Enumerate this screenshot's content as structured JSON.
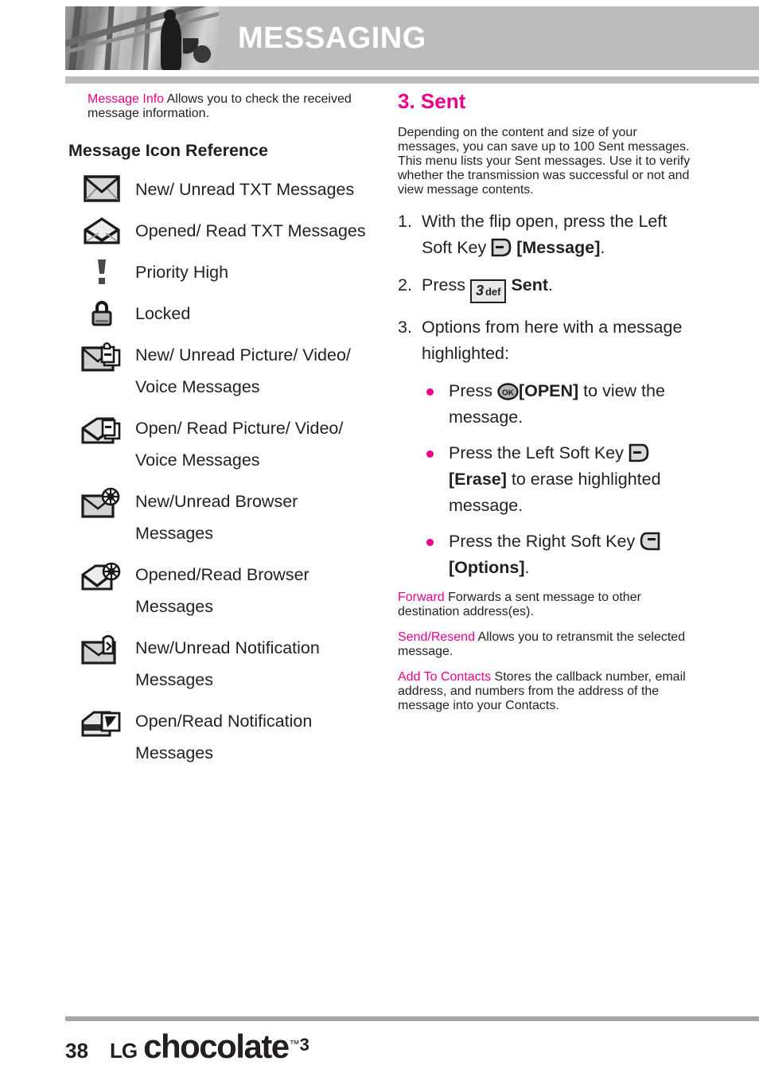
{
  "header": {
    "title": "MESSAGING"
  },
  "left": {
    "message_info": {
      "term": "Message Info",
      "body": " Allows you to check the received message information."
    },
    "icon_reference_heading": "Message Icon Reference",
    "icons": [
      {
        "icon": "envelope-closed-icon",
        "label": "New/ Unread TXT Messages"
      },
      {
        "icon": "envelope-open-icon",
        "label": "Opened/ Read TXT Messages"
      },
      {
        "icon": "exclamation-priority-icon",
        "label": "Priority High"
      },
      {
        "icon": "padlock-icon",
        "label": "Locked"
      },
      {
        "icon": "envelope-closed-media-icon",
        "label": "New/ Unread Picture/ Video/ Voice Messages"
      },
      {
        "icon": "envelope-open-media-icon",
        "label": "Open/ Read Picture/ Video/ Voice Messages"
      },
      {
        "icon": "envelope-closed-browser-icon",
        "label": "New/Unread Browser Messages"
      },
      {
        "icon": "envelope-open-browser-icon",
        "label": "Opened/Read Browser Messages"
      },
      {
        "icon": "envelope-closed-notify-icon",
        "label": "New/Unread Notification Messages"
      },
      {
        "icon": "envelope-open-notify-icon",
        "label": "Open/Read Notification Messages"
      }
    ]
  },
  "right": {
    "section_title": "3. Sent",
    "intro": "Depending on the content and size of your messages, you can save up to 100 Sent messages. This menu lists your Sent messages. Use it to verify whether the transmission was successful or not and view message contents.",
    "steps": [
      {
        "num": "1.",
        "pre": "With the flip open, press the Left Soft Key ",
        "key_icon": "left-soft-key-icon",
        "bold": "[Message]",
        "post": "."
      },
      {
        "num": "2.",
        "pre": "Press ",
        "key_digit": "3",
        "key_letters": "def",
        "bold": "Sent",
        "post": "."
      },
      {
        "num": "3.",
        "pre": "Options from here with a message highlighted:",
        "bold": "",
        "post": ""
      }
    ],
    "bullets": [
      {
        "pre": "Press ",
        "key_icon": "ok-key-icon",
        "bold": "[OPEN]",
        "post": " to view the message."
      },
      {
        "pre": "Press the Left Soft Key ",
        "key_icon": "left-soft-key-icon",
        "bold": "[Erase]",
        "post": " to erase highlighted message."
      },
      {
        "pre": "Press the Right Soft Key ",
        "key_icon": "right-soft-key-icon",
        "bold": "[Options]",
        "post": "."
      }
    ],
    "terms": [
      {
        "term": "Forward",
        "body": " Forwards a sent message to other destination address(es)."
      },
      {
        "term": "Send/Resend",
        "body": " Allows you to retransmit the selected message."
      },
      {
        "term": "Add To Contacts",
        "body": " Stores the callback number, email address, and numbers from the address of the message into your Contacts."
      }
    ]
  },
  "footer": {
    "page_number": "38",
    "brand_lg": "LG",
    "brand_name": "chocolate",
    "brand_tm": "™",
    "brand_version": "3"
  },
  "colors": {
    "accent": "#ec008c",
    "header_bar": "#bcbcbc",
    "text": "#231f20"
  }
}
